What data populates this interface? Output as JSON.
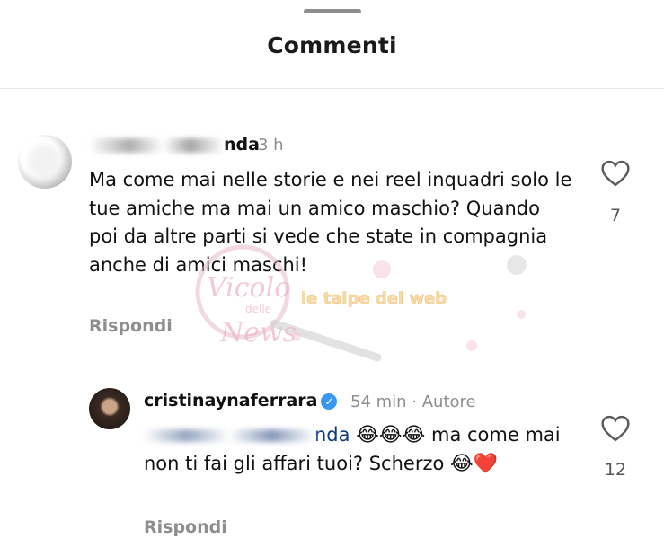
{
  "header": {
    "title": "Commenti"
  },
  "comments": [
    {
      "username_visible": "nda",
      "time": "3 h",
      "text": "Ma come mai nelle storie e nei reel inquadri solo le tue amiche ma mai un amico maschio? Quando poi da altre parti si vede che state in compagnia anche di amici maschi!",
      "reply_label": "Rispondi",
      "likes": "7",
      "heart_icon": "heart-outline-icon"
    },
    {
      "username": "cristinaynaferrara",
      "verified_icon": "verified-badge-icon",
      "time": "54 min · Autore",
      "mention_visible": "nda",
      "text_after_mention": " ma come mai non ti fai gli affari tuoi? Scherzo ",
      "reply_label": "Rispondi",
      "likes": "12",
      "heart_icon": "heart-outline-icon"
    }
  ],
  "watermark": {
    "text1": "Vicolo",
    "text2": "delle",
    "text3": "News",
    "text4": "le talpe del web"
  },
  "colors": {
    "accent": "#3897f0",
    "muted": "#8e8e8e",
    "mention": "#0b3c7a"
  }
}
